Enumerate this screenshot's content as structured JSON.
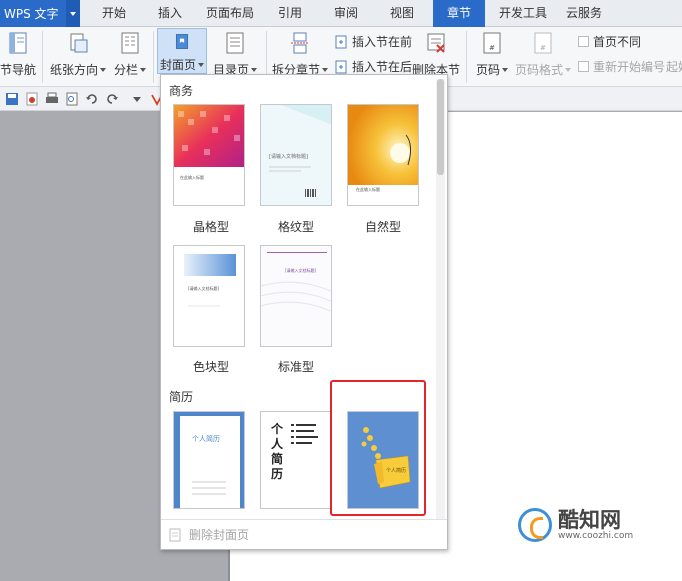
{
  "app": {
    "name": "WPS 文字"
  },
  "tabs": [
    "开始",
    "插入",
    "页面布局",
    "引用",
    "审阅",
    "视图",
    "章节",
    "开发工具",
    "云服务"
  ],
  "active_tab": "章节",
  "ribbon": {
    "nav_label": "节导航",
    "orientation_label": "纸张方向",
    "columns_label": "分栏",
    "cover_label": "封面页",
    "toc_label": "目录页",
    "split_label": "拆分章节",
    "insert_before_label": "插入节在前",
    "insert_after_label": "插入节在后",
    "delete_section_label": "删除本节",
    "page_number_label": "页码",
    "page_number_format_label": "页码格式",
    "first_page_diff_label": "首页不同",
    "restart_numbering_label": "重新开始编号",
    "overflow_label": "起始"
  },
  "panel": {
    "section_business": "商务",
    "section_resume": "简历",
    "business_items": [
      {
        "label": "晶格型",
        "thumb_text": "在此输入标题"
      },
      {
        "label": "格纹型",
        "thumb_text": "[请输入文档标题]"
      },
      {
        "label": "自然型",
        "thumb_text": "在此输入标题"
      },
      {
        "label": "色块型",
        "thumb_text": "[请输入文档标题]"
      },
      {
        "label": "标准型",
        "thumb_text": "[请输入文档标题]"
      }
    ],
    "resume_items": [
      {
        "thumb_text": "个人简历"
      },
      {
        "thumb_text": "个人简历"
      },
      {
        "thumb_text": "个人简历"
      }
    ],
    "delete_cover_label": "删除封面页"
  },
  "watermark": {
    "name": "酷知网",
    "url": "www.coozhi.com"
  },
  "colors": {
    "accent": "#2a6bc9",
    "highlight": "#e2262b"
  }
}
